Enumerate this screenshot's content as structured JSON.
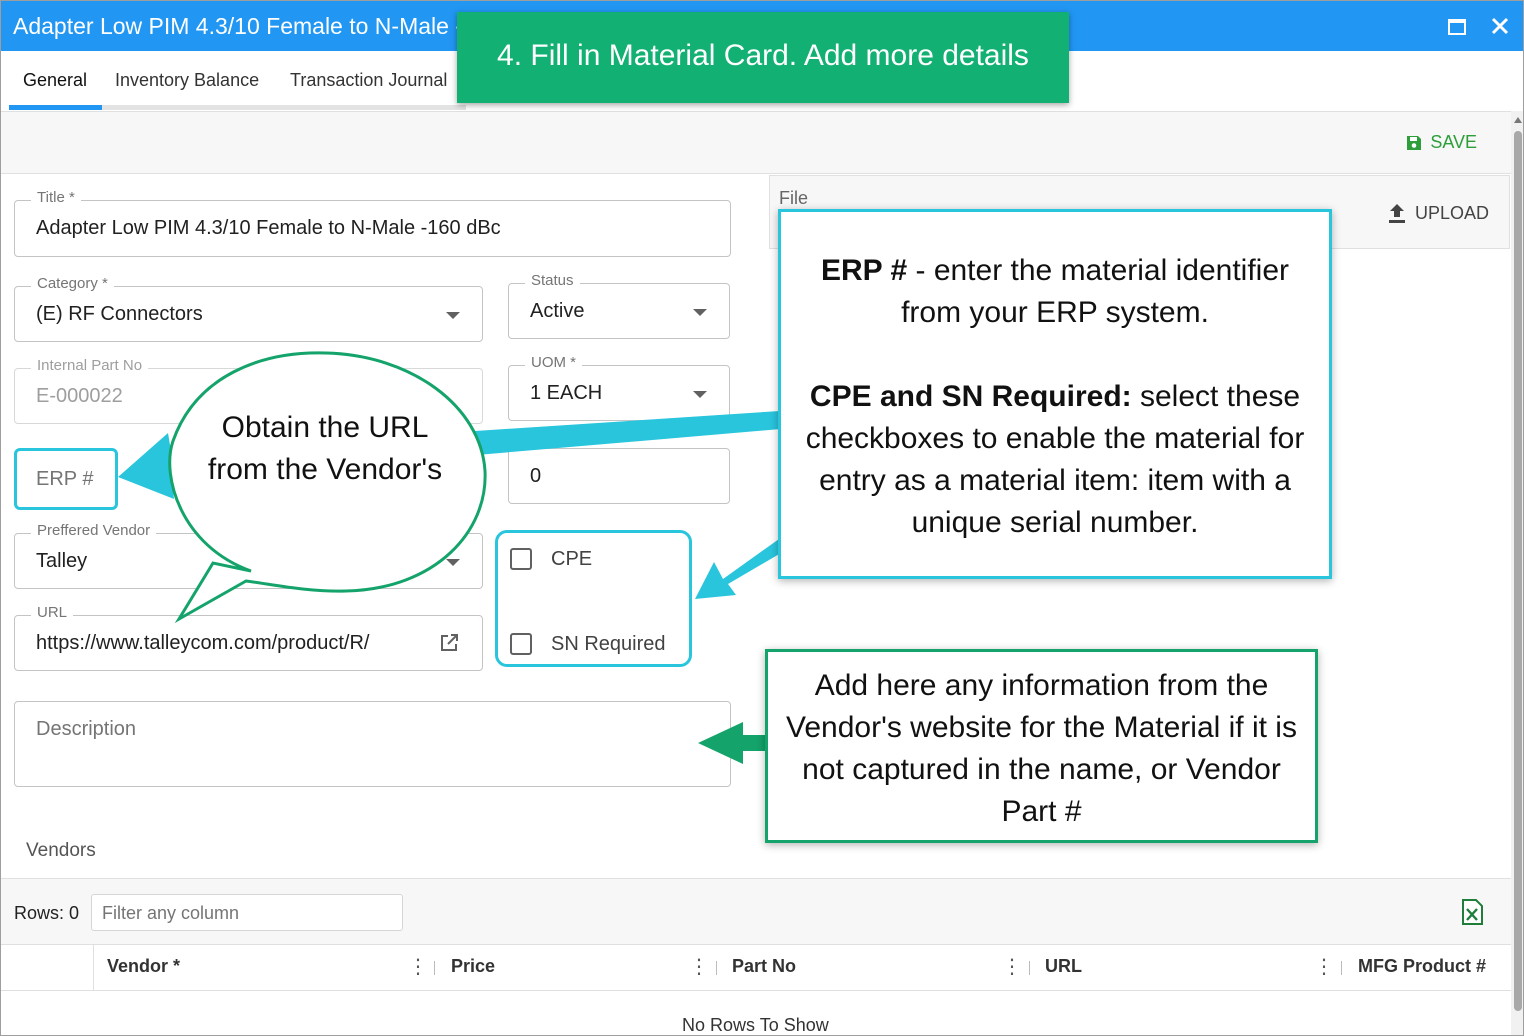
{
  "window": {
    "title": "Adapter Low PIM 4.3/10 Female to N-Male -160 dBc",
    "maximize_icon": "maximize-icon",
    "close_icon": "close-icon"
  },
  "tabs": [
    {
      "label": "General",
      "active": true
    },
    {
      "label": "Inventory Balance",
      "active": false
    },
    {
      "label": "Transaction Journal",
      "active": false
    }
  ],
  "toolbar": {
    "save_label": "SAVE",
    "save_icon": "save-icon"
  },
  "form": {
    "title": {
      "label": "Title *",
      "value": "Adapter Low PIM 4.3/10 Female to N-Male -160 dBc"
    },
    "category": {
      "label": "Category *",
      "value": "(E) RF Connectors"
    },
    "status": {
      "label": "Status",
      "value": "Active"
    },
    "internal_part_no": {
      "label": "Internal Part No",
      "value": "E-000022"
    },
    "uom": {
      "label": "UOM *",
      "value": "1 EACH"
    },
    "erp": {
      "placeholder": "ERP #"
    },
    "cost": {
      "value": "0"
    },
    "preferred_vendor": {
      "label": "Preffered Vendor",
      "value": "Talley"
    },
    "url": {
      "label": "URL",
      "value": "https://www.talleycom.com/product/R/",
      "icon": "open-external-icon"
    },
    "cpe": {
      "label": "CPE",
      "checked": false
    },
    "sn_required": {
      "label": "SN Required",
      "checked": false
    },
    "description": {
      "placeholder": "Description"
    }
  },
  "file": {
    "label": "File",
    "upload_label": "UPLOAD",
    "upload_icon": "upload-icon"
  },
  "vendors": {
    "section_title": "Vendors",
    "rows_label": "Rows: 0",
    "filter_placeholder": "Filter any column",
    "excel_icon": "excel-export-icon",
    "columns": [
      "Vendor *",
      "Price",
      "Part No",
      "URL",
      "MFG Product #"
    ],
    "empty_text": "No Rows To Show"
  },
  "annotations": {
    "step_banner": "4. Fill in Material Card. Add more details",
    "url_bubble": "Obtain the URL from the Vendor's",
    "erp_note_bold": "ERP #",
    "erp_note_text": " - enter the material identifier from your ERP system.",
    "cpe_note_bold": "CPE and SN Required:",
    "cpe_note_text": " select these checkboxes to enable the material for entry as a material item: item with a unique serial number.",
    "description_note": "Add here any information from the Vendor's website for the Material if it is not captured in the name, or Vendor Part #"
  },
  "colors": {
    "titlebar": "#2196f3",
    "save": "#2e9e3a",
    "banner": "#13b073",
    "callout_cyan": "#29c5dd",
    "callout_green": "#14a36a"
  }
}
